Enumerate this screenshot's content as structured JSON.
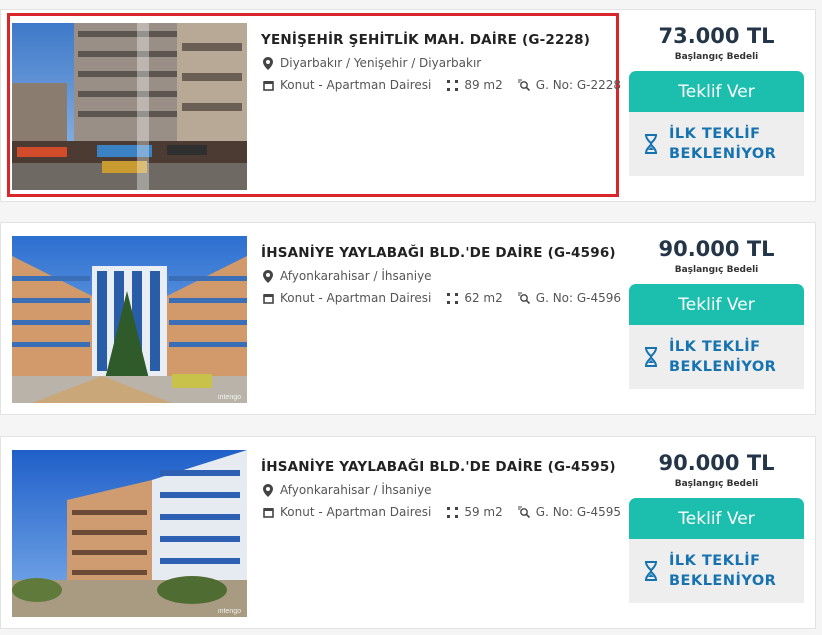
{
  "listings": [
    {
      "title": "YENİŞEHİR ŞEHİTLİK MAH. DAİRE (G-2228)",
      "location": "Diyarbakır / Yenişehir / Diyarbakır",
      "category": "Konut - Apartman Dairesi",
      "area": "89 m2",
      "gno": "G. No: G-2228",
      "price": "73.000 TL",
      "price_label": "Başlangıç Bedeli",
      "bid_button": "Teklif Ver",
      "status_line1": "İLK TEKLİF",
      "status_line2": "BEKLENİYOR",
      "image_alt": "apartment building photo",
      "selected": true
    },
    {
      "title": "İHSANİYE YAYLABAĞI BLD.'DE DAİRE (G-4596)",
      "location": "Afyonkarahisar / İhsaniye",
      "category": "Konut - Apartman Dairesi",
      "area": "62 m2",
      "gno": "G. No: G-4596",
      "price": "90.000 TL",
      "price_label": "Başlangıç Bedeli",
      "bid_button": "Teklif Ver",
      "status_line1": "İLK TEKLİF",
      "status_line2": "BEKLENİYOR",
      "image_alt": "apartment complex photo",
      "watermark": "intengo"
    },
    {
      "title": "İHSANİYE YAYLABAĞI BLD.'DE DAİRE (G-4595)",
      "location": "Afyonkarahisar / İhsaniye",
      "category": "Konut - Apartman Dairesi",
      "area": "59 m2",
      "gno": "G. No: G-4595",
      "price": "90.000 TL",
      "price_label": "Başlangıç Bedeli",
      "bid_button": "Teklif Ver",
      "status_line1": "İLK TEKLİF",
      "status_line2": "BEKLENİYOR",
      "image_alt": "apartment complex photo",
      "watermark": "intengo"
    }
  ],
  "colors": {
    "accent": "#1cbfae",
    "status_text": "#1673b0",
    "selection_border": "#d9262b",
    "price_text": "#243547"
  }
}
